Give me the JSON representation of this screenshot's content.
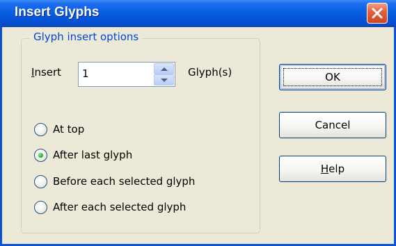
{
  "window": {
    "title": "Insert Glyphs"
  },
  "group": {
    "legend": "Glyph insert options"
  },
  "insert": {
    "label_mnemonic": "I",
    "label_rest": "nsert",
    "value": "1",
    "suffix": "Glyph(s)"
  },
  "options": [
    {
      "label": "At top",
      "checked": false
    },
    {
      "label": "After last glyph",
      "checked": true
    },
    {
      "label": "Before each selected glyph",
      "checked": false
    },
    {
      "label": "After each selected glyph",
      "checked": false
    }
  ],
  "buttons": {
    "ok": "OK",
    "cancel": "Cancel",
    "help_mnemonic": "H",
    "help_rest": "elp"
  },
  "icons": {
    "close": "close-icon",
    "spin_up": "triangle-up-icon",
    "spin_down": "triangle-down-icon"
  }
}
